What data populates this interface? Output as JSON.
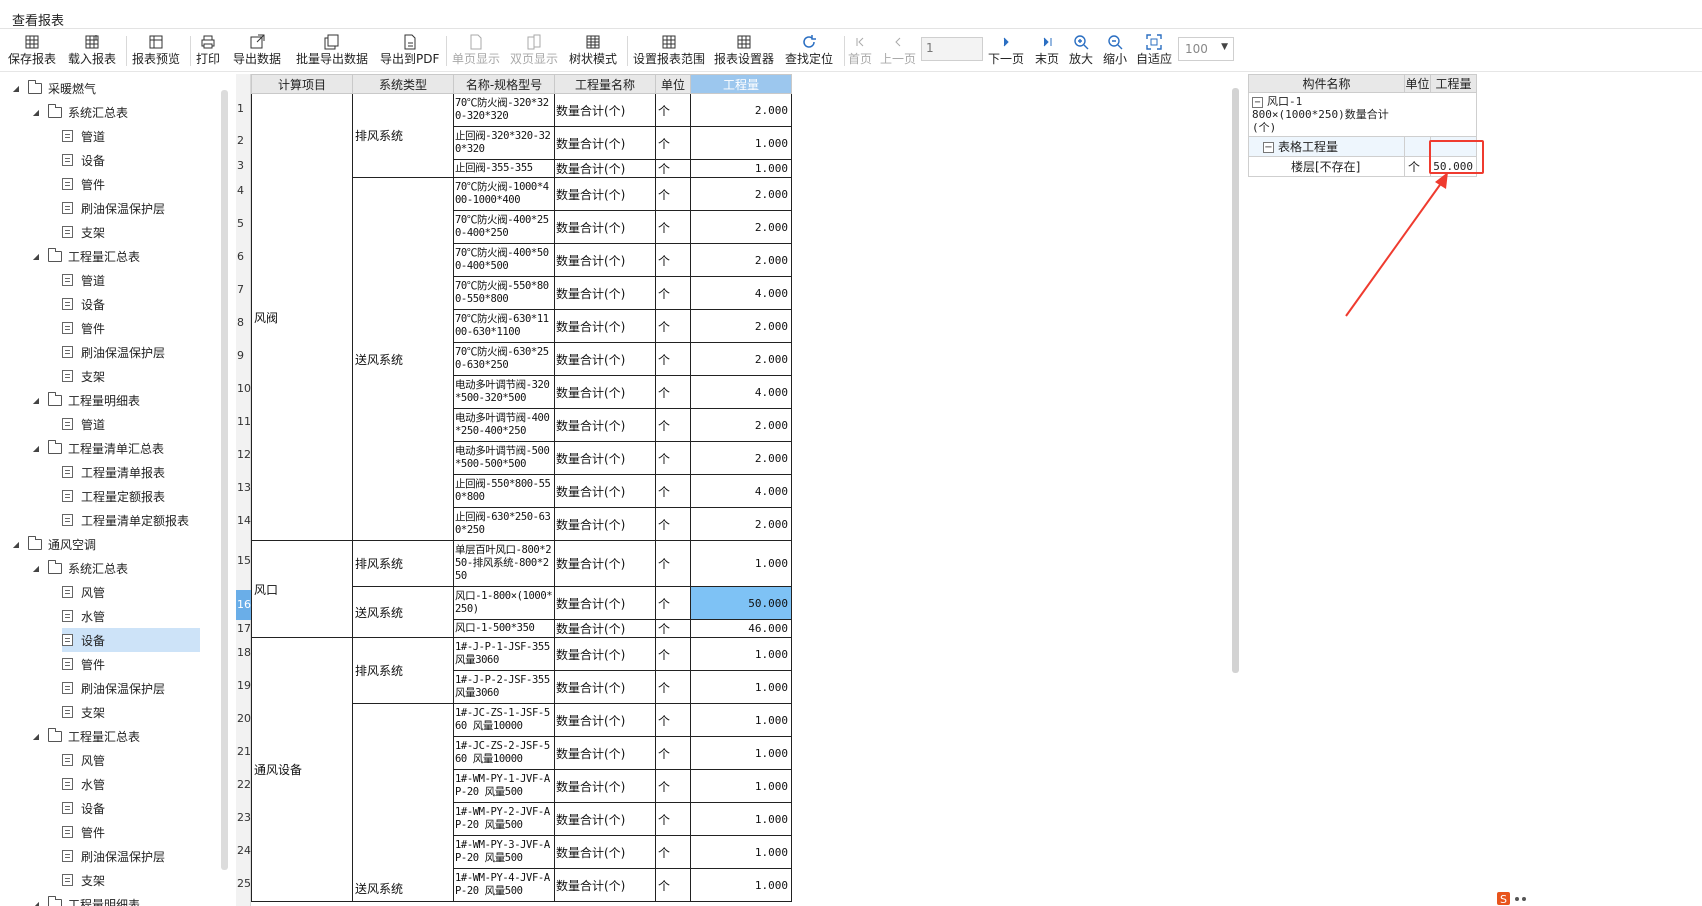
{
  "window": {
    "title": "查看报表"
  },
  "toolbar": {
    "save_report": "保存报表",
    "load_report": "载入报表",
    "preview": "报表预览",
    "print": "打印",
    "export_data": "导出数据",
    "batch_export": "批量导出数据",
    "export_pdf": "导出到PDF",
    "single_page": "单页显示",
    "double_page": "双页显示",
    "tree_mode": "树状模式",
    "set_range": "设置报表范围",
    "report_settings": "报表设置器",
    "find_locate": "查找定位",
    "first_page": "首页",
    "prev_page": "上一页",
    "page_value": "1",
    "next_page": "下一页",
    "last_page": "末页",
    "zoom_in": "放大",
    "zoom_out": "缩小",
    "fit": "自适应",
    "zoom_value": "100"
  },
  "tree": [
    {
      "label": "采暖燃气"
    },
    {
      "label": "系统汇总表"
    },
    {
      "label": "管道"
    },
    {
      "label": "设备"
    },
    {
      "label": "管件"
    },
    {
      "label": "刷油保温保护层"
    },
    {
      "label": "支架"
    },
    {
      "label": "工程量汇总表"
    },
    {
      "label": "管道"
    },
    {
      "label": "设备"
    },
    {
      "label": "管件"
    },
    {
      "label": "刷油保温保护层"
    },
    {
      "label": "支架"
    },
    {
      "label": "工程量明细表"
    },
    {
      "label": "管道"
    },
    {
      "label": "工程量清单汇总表"
    },
    {
      "label": "工程量清单报表"
    },
    {
      "label": "工程量定额报表"
    },
    {
      "label": "工程量清单定额报表"
    },
    {
      "label": "通风空调"
    },
    {
      "label": "系统汇总表"
    },
    {
      "label": "风管"
    },
    {
      "label": "水管"
    },
    {
      "label": "设备"
    },
    {
      "label": "管件"
    },
    {
      "label": "刷油保温保护层"
    },
    {
      "label": "支架"
    },
    {
      "label": "工程量汇总表"
    },
    {
      "label": "风管"
    },
    {
      "label": "水管"
    },
    {
      "label": "设备"
    },
    {
      "label": "管件"
    },
    {
      "label": "刷油保温保护层"
    },
    {
      "label": "支架"
    },
    {
      "label": "工程量明细表"
    }
  ],
  "report": {
    "headers": [
      "计算项目",
      "系统类型",
      "名称-规格型号",
      "工程量名称",
      "单位",
      "工程量"
    ],
    "groups": {
      "fengfa": "风阀",
      "fengkou": "风口",
      "tongfeng": "通风设备",
      "paifeng": "排风系统",
      "songfeng": "送风系统"
    },
    "rows": [
      {
        "n": "1",
        "spec": "70℃防火阀-320*320-320*320",
        "name": "数量合计(个)",
        "unit": "个",
        "qty": "2.000"
      },
      {
        "n": "2",
        "spec": "止回阀-320*320-320*320",
        "name": "数量合计(个)",
        "unit": "个",
        "qty": "1.000"
      },
      {
        "n": "3",
        "spec": "止回阀-355-355",
        "name": "数量合计(个)",
        "unit": "个",
        "qty": "1.000"
      },
      {
        "n": "4",
        "spec": "70℃防火阀-1000*400-1000*400",
        "name": "数量合计(个)",
        "unit": "个",
        "qty": "2.000"
      },
      {
        "n": "5",
        "spec": "70℃防火阀-400*250-400*250",
        "name": "数量合计(个)",
        "unit": "个",
        "qty": "2.000"
      },
      {
        "n": "6",
        "spec": "70℃防火阀-400*500-400*500",
        "name": "数量合计(个)",
        "unit": "个",
        "qty": "2.000"
      },
      {
        "n": "7",
        "spec": "70℃防火阀-550*800-550*800",
        "name": "数量合计(个)",
        "unit": "个",
        "qty": "4.000"
      },
      {
        "n": "8",
        "spec": "70℃防火阀-630*1100-630*1100",
        "name": "数量合计(个)",
        "unit": "个",
        "qty": "2.000"
      },
      {
        "n": "9",
        "spec": "70℃防火阀-630*250-630*250",
        "name": "数量合计(个)",
        "unit": "个",
        "qty": "2.000"
      },
      {
        "n": "10",
        "spec": "电动多叶调节阀-320*500-320*500",
        "name": "数量合计(个)",
        "unit": "个",
        "qty": "4.000"
      },
      {
        "n": "11",
        "spec": "电动多叶调节阀-400*250-400*250",
        "name": "数量合计(个)",
        "unit": "个",
        "qty": "2.000"
      },
      {
        "n": "12",
        "spec": "电动多叶调节阀-500*500-500*500",
        "name": "数量合计(个)",
        "unit": "个",
        "qty": "2.000"
      },
      {
        "n": "13",
        "spec": "止回阀-550*800-550*800",
        "name": "数量合计(个)",
        "unit": "个",
        "qty": "4.000"
      },
      {
        "n": "14",
        "spec": "止回阀-630*250-630*250",
        "name": "数量合计(个)",
        "unit": "个",
        "qty": "2.000"
      },
      {
        "n": "15",
        "spec": "单层百叶风口-800*250-排风系统-800*250",
        "name": "数量合计(个)",
        "unit": "个",
        "qty": "1.000"
      },
      {
        "n": "16",
        "spec": "风口-1-800×(1000*250)",
        "name": "数量合计(个)",
        "unit": "个",
        "qty": "50.000"
      },
      {
        "n": "17",
        "spec": "风口-1-500*350",
        "name": "数量合计(个)",
        "unit": "个",
        "qty": "46.000"
      },
      {
        "n": "18",
        "spec": "1#-J-P-1-JSF-355风量3060",
        "name": "数量合计(个)",
        "unit": "个",
        "qty": "1.000"
      },
      {
        "n": "19",
        "spec": "1#-J-P-2-JSF-355风量3060",
        "name": "数量合计(个)",
        "unit": "个",
        "qty": "1.000"
      },
      {
        "n": "20",
        "spec": "1#-JC-ZS-1-JSF-560  风量10000",
        "name": "数量合计(个)",
        "unit": "个",
        "qty": "1.000"
      },
      {
        "n": "21",
        "spec": "1#-JC-ZS-2-JSF-560  风量10000",
        "name": "数量合计(个)",
        "unit": "个",
        "qty": "1.000"
      },
      {
        "n": "22",
        "spec": "1#-WM-PY-1-JVF-AP-20  风量500",
        "name": "数量合计(个)",
        "unit": "个",
        "qty": "1.000"
      },
      {
        "n": "23",
        "spec": "1#-WM-PY-2-JVF-AP-20  风量500",
        "name": "数量合计(个)",
        "unit": "个",
        "qty": "1.000"
      },
      {
        "n": "24",
        "spec": "1#-WM-PY-3-JVF-AP-20  风量500",
        "name": "数量合计(个)",
        "unit": "个",
        "qty": "1.000"
      },
      {
        "n": "25",
        "spec": "1#-WM-PY-4-JVF-AP-20  风量500",
        "name": "数量合计(个)",
        "unit": "个",
        "qty": "1.000"
      }
    ]
  },
  "component": {
    "headers": [
      "构件名称",
      "单位",
      "工程量"
    ],
    "item": "风口-1 800×(1000*250)数量合计(个)",
    "group": "表格工程量",
    "floor": "楼层[不存在]",
    "unit": "个",
    "qty": "50.000"
  },
  "colors": {
    "highlight": "#7ec2f5",
    "annotation": "#ef3b2f",
    "selected_tree": "#cde3f8"
  }
}
